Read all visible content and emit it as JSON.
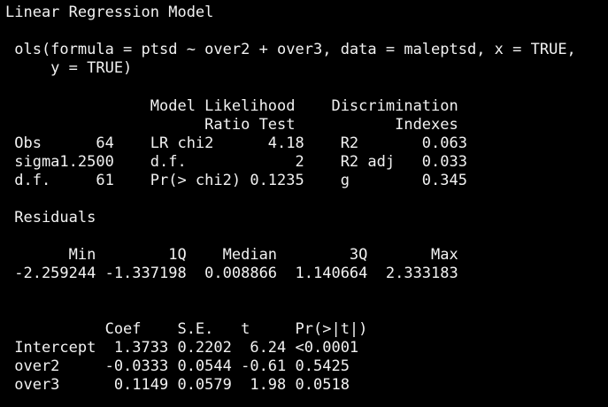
{
  "colors": {
    "background": "#000000",
    "text": "#f2f2f2"
  },
  "output": {
    "title": "Linear Regression Model",
    "call_line1": " ols(formula = ptsd ~ over2 + over3, data = maleptsd, x = TRUE,",
    "call_line2": "     y = TRUE)",
    "stats_header1": "                Model Likelihood    Discrimination",
    "stats_header2": "                      Ratio Test           Indexes",
    "stats_row_obs": " Obs      64    LR chi2      4.18    R2       0.063",
    "stats_row_sigma": " sigma1.2500    d.f.            2    R2 adj   0.033",
    "stats_row_df": " d.f.     61    Pr(> chi2) 0.1235    g        0.345",
    "residuals_label": " Residuals",
    "residuals_header": "       Min        1Q    Median        3Q       Max",
    "residuals_values": " -2.259244 -1.337198  0.008866  1.140664  2.333183",
    "coef_header": "           Coef    S.E.   t     Pr(>|t|)",
    "coef_row_intercept": " Intercept  1.3733 0.2202  6.24 <0.0001",
    "coef_row_over2": " over2     -0.0333 0.0544 -0.61 0.5425",
    "coef_row_over3": " over3      0.1149 0.0579  1.98 0.0518"
  }
}
